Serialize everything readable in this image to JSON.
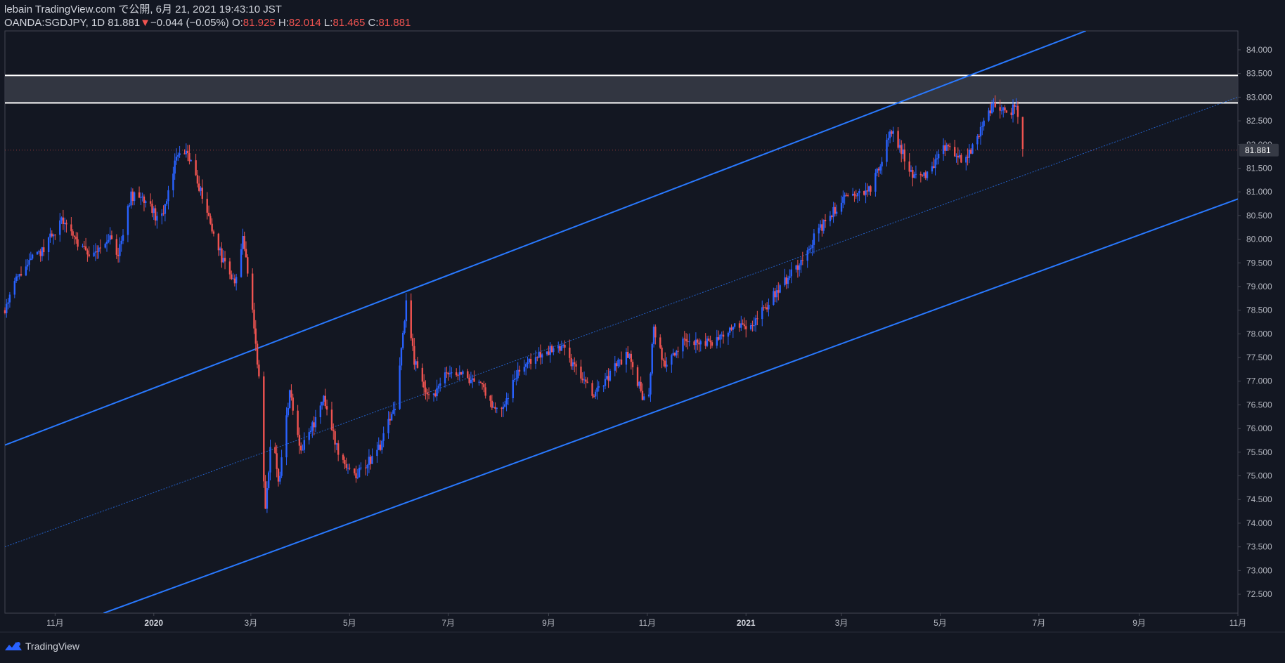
{
  "header": {
    "publish_line": "lebain TradingView.com で公開, 6月 21, 2021 19:43:10 JST",
    "symbol": "OANDA:SGDJPY, 1D",
    "last": "81.881",
    "change": "−0.044 (−0.05%)",
    "o_label": "O:",
    "o_value": "81.925",
    "h_label": "H:",
    "h_value": "82.014",
    "l_label": "L:",
    "l_value": "81.465",
    "c_label": "C:",
    "c_value": "81.881"
  },
  "footer": {
    "brand": "TradingView"
  },
  "colors": {
    "background": "#131722",
    "up_candle": "#2962ff",
    "down_candle": "#ef5350",
    "channel": "#2979ff",
    "resistance_zone": "#363a45",
    "resistance_line": "#ffffff",
    "axis_text": "#b2b5be"
  },
  "chart_data": {
    "type": "candlestick",
    "symbol": "OANDA:SGDJPY",
    "interval": "1D",
    "ylim": [
      72.1,
      84.4
    ],
    "y_ticks": [
      72.5,
      73.0,
      73.5,
      74.0,
      74.5,
      75.0,
      75.5,
      76.0,
      76.5,
      77.0,
      77.5,
      78.0,
      78.5,
      79.0,
      79.5,
      80.0,
      80.5,
      81.0,
      81.5,
      82.0,
      82.5,
      83.0,
      83.5,
      84.0
    ],
    "y_tick_labels": [
      "72.500",
      "73.000",
      "73.500",
      "74.000",
      "74.500",
      "75.000",
      "75.500",
      "76.000",
      "76.500",
      "77.000",
      "77.500",
      "78.000",
      "78.500",
      "79.000",
      "79.500",
      "80.000",
      "80.500",
      "81.000",
      "81.500",
      "82.000",
      "82.500",
      "83.000",
      "83.500",
      "84.000"
    ],
    "x_start": "2019-10-01",
    "x_end": "2021-11-01",
    "x_ticks": [
      {
        "date": "2019-11-01",
        "label": "11月",
        "bold": false
      },
      {
        "date": "2020-01-01",
        "label": "2020",
        "bold": true
      },
      {
        "date": "2020-03-01",
        "label": "3月",
        "bold": false
      },
      {
        "date": "2020-05-01",
        "label": "5月",
        "bold": false
      },
      {
        "date": "2020-07-01",
        "label": "7月",
        "bold": false
      },
      {
        "date": "2020-09-01",
        "label": "9月",
        "bold": false
      },
      {
        "date": "2020-11-01",
        "label": "11月",
        "bold": false
      },
      {
        "date": "2021-01-01",
        "label": "2021",
        "bold": true
      },
      {
        "date": "2021-03-01",
        "label": "3月",
        "bold": false
      },
      {
        "date": "2021-05-01",
        "label": "5月",
        "bold": false
      },
      {
        "date": "2021-07-01",
        "label": "7月",
        "bold": false
      },
      {
        "date": "2021-09-01",
        "label": "9月",
        "bold": false
      },
      {
        "date": "2021-11-01",
        "label": "11月",
        "bold": false
      }
    ],
    "last_price": 81.881,
    "last_price_label": "81.881",
    "resistance_zone": [
      82.88,
      83.46
    ],
    "channel": {
      "upper": [
        {
          "date": "2019-10-01",
          "price": 75.65
        },
        {
          "date": "2021-07-30",
          "price": 84.4
        }
      ],
      "lower": [
        {
          "date": "2019-12-01",
          "price": 72.1
        },
        {
          "date": "2021-11-01",
          "price": 80.85
        }
      ],
      "mid": [
        {
          "date": "2019-10-01",
          "price": 73.5
        },
        {
          "date": "2021-11-01",
          "price": 83.0
        }
      ]
    },
    "price_path": [
      [
        "2019-10-01",
        78.5
      ],
      [
        "2019-10-10",
        79.3
      ],
      [
        "2019-10-25",
        79.8
      ],
      [
        "2019-11-05",
        80.4
      ],
      [
        "2019-11-20",
        79.7
      ],
      [
        "2019-12-05",
        80.0
      ],
      [
        "2019-12-10",
        79.7
      ],
      [
        "2019-12-18",
        80.9
      ],
      [
        "2019-12-28",
        80.8
      ],
      [
        "2020-01-05",
        80.3
      ],
      [
        "2020-01-15",
        81.7
      ],
      [
        "2020-01-22",
        81.8
      ],
      [
        "2020-02-01",
        80.8
      ],
      [
        "2020-02-12",
        79.6
      ],
      [
        "2020-02-20",
        79.0
      ],
      [
        "2020-02-25",
        80.0
      ],
      [
        "2020-03-02",
        78.6
      ],
      [
        "2020-03-06",
        77.0
      ],
      [
        "2020-03-10",
        74.2
      ],
      [
        "2020-03-14",
        76.0
      ],
      [
        "2020-03-18",
        74.8
      ],
      [
        "2020-03-25",
        76.8
      ],
      [
        "2020-04-01",
        75.5
      ],
      [
        "2020-04-15",
        76.6
      ],
      [
        "2020-04-25",
        75.4
      ],
      [
        "2020-05-05",
        75.0
      ],
      [
        "2020-05-20",
        75.6
      ],
      [
        "2020-05-30",
        76.6
      ],
      [
        "2020-06-05",
        78.6
      ],
      [
        "2020-06-10",
        77.4
      ],
      [
        "2020-06-20",
        76.6
      ],
      [
        "2020-07-01",
        77.2
      ],
      [
        "2020-07-20",
        77.0
      ],
      [
        "2020-08-01",
        76.3
      ],
      [
        "2020-08-15",
        77.3
      ],
      [
        "2020-08-28",
        77.6
      ],
      [
        "2020-09-10",
        77.7
      ],
      [
        "2020-09-28",
        76.7
      ],
      [
        "2020-10-10",
        77.2
      ],
      [
        "2020-10-20",
        77.6
      ],
      [
        "2020-11-01",
        76.4
      ],
      [
        "2020-11-05",
        78.1
      ],
      [
        "2020-11-12",
        77.3
      ],
      [
        "2020-11-25",
        77.9
      ],
      [
        "2020-12-10",
        77.8
      ],
      [
        "2020-12-25",
        78.2
      ],
      [
        "2021-01-05",
        78.2
      ],
      [
        "2021-01-20",
        78.9
      ],
      [
        "2021-02-01",
        79.4
      ],
      [
        "2021-02-15",
        80.2
      ],
      [
        "2021-03-01",
        80.8
      ],
      [
        "2021-03-20",
        81.1
      ],
      [
        "2021-04-01",
        82.3
      ],
      [
        "2021-04-15",
        81.3
      ],
      [
        "2021-04-25",
        81.4
      ],
      [
        "2021-05-05",
        82.0
      ],
      [
        "2021-05-15",
        81.6
      ],
      [
        "2021-05-25",
        82.2
      ],
      [
        "2021-06-03",
        82.9
      ],
      [
        "2021-06-12",
        82.6
      ],
      [
        "2021-06-17",
        82.9
      ],
      [
        "2021-06-21",
        81.88
      ]
    ]
  }
}
